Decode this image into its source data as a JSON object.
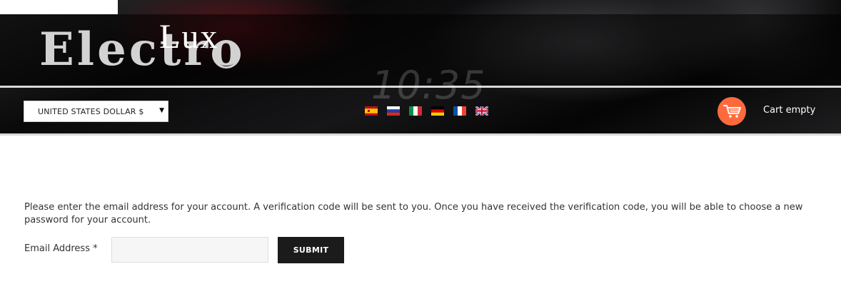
{
  "header": {
    "logo": {
      "main": "Electro",
      "accent": "Lux"
    },
    "background_clock": "10:35",
    "currency": {
      "selected": "UNITED STATES DOLLAR $"
    },
    "languages": [
      "Spanish",
      "Russian",
      "Italian",
      "German",
      "French",
      "English"
    ],
    "cart": {
      "label": "Cart empty",
      "accent_color": "#ff6a3d"
    }
  },
  "form": {
    "instructions": "Please enter the email address for your account. A verification code will be sent to you. Once you have received the verification code, you will be able to choose a new password for your account.",
    "email_label": "Email Address *",
    "email_value": "",
    "email_placeholder": "",
    "submit_label": "SUBMIT"
  }
}
